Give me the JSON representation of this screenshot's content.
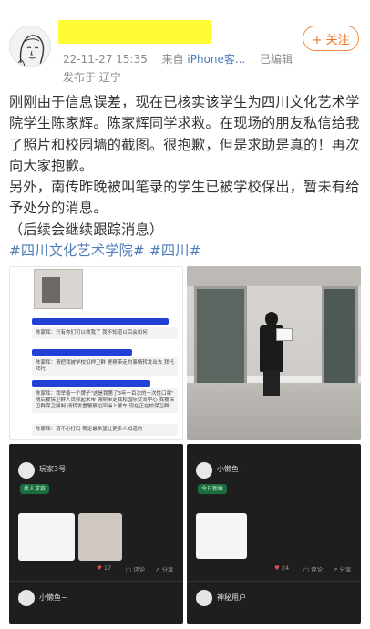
{
  "header": {
    "timestamp": "22-11-27 15:35",
    "source_prefix": "来自",
    "source_device": "iPhone客...",
    "edited": "已编辑",
    "ip_location": "发布于 辽宁",
    "follow_label": "+ 关注"
  },
  "post": {
    "paragraph1": "刚刚由于信息误差，现在已核实该学生为四川文化艺术学院学生陈家辉。陈家辉同学求救。在现场的朋友私信给我了照片和校园墙的截图。很抱歉，但是求助是真的！再次向大家抱歉。",
    "paragraph2": "另外，南传昨晚被叫笔录的学生已被学校保出，暂未有给予处分的消息。",
    "paragraph3": "（后续会继续跟踪消息）",
    "tags": "#四川文化艺术学院# #四川#"
  },
  "images": {
    "chat_shot": {
      "bubble1": "陈家辉：只有你们可以救我了 我不知道以后会如何",
      "bubble2": "陈家辉：请把我被学校扣押卫群 警察带走的事情转发出去 拜托拜托",
      "bubble3": "陈家辉：我举着一个牌子\"这是我第了3年一百次的一次性口罩\" 随后被保卫群人员抓起来带 强制带走我和国际交流中心 我被保卫群保卫强制 请转发重警察拉回操上警车 现在正在校保卫群",
      "bubble4": "陈家辉：请不必打码 我是最希望让更多人知道的"
    },
    "app_left": {
      "name": "玩家3号",
      "tag": "找人求救",
      "likes": "17",
      "comment": "评论",
      "share": "分享",
      "next_name": "小懒鱼~"
    },
    "app_right": {
      "name": "小懒鱼~",
      "tag": "今日新鲜",
      "likes": "24",
      "comment": "评论",
      "share": "分享",
      "next_name": "神秘用户"
    }
  },
  "colors": {
    "link": "#4f7cb8",
    "follow": "#f0731f",
    "redaction": "#fffc36"
  }
}
